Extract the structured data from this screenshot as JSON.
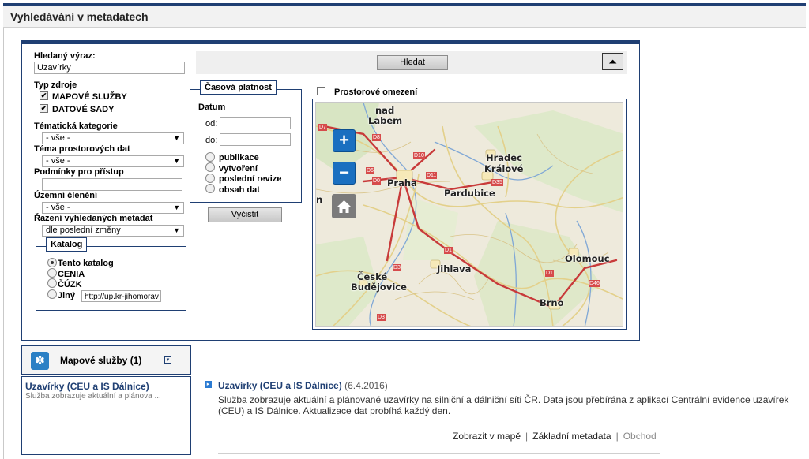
{
  "page": {
    "title": "Vyhledávání v metadatech"
  },
  "search": {
    "label": "Hledaný výraz:",
    "value": "Uzavírky",
    "button": "Hledat",
    "clear_button": "Vyčistit",
    "collapse_icon": "double-chevron-up-icon"
  },
  "source_type": {
    "label": "Typ zdroje",
    "options": [
      {
        "label": "MAPOVÉ SLUŽBY",
        "checked": true
      },
      {
        "label": "DATOVÉ SADY",
        "checked": true
      }
    ]
  },
  "filters": {
    "thematic_category": {
      "label": "Tématická kategorie",
      "value": "- vše -"
    },
    "spatial_theme": {
      "label": "Téma prostorových dat",
      "value": "- vše -"
    },
    "access_conditions": {
      "label": "Podmínky pro přístup",
      "value": ""
    },
    "territorial": {
      "label": "Územní členění",
      "value": "- vše -"
    },
    "sorting": {
      "label": "Řazení vyhledaných metadat",
      "value": "dle poslední změny"
    }
  },
  "catalog": {
    "legend": "Katalog",
    "options": [
      "Tento katalog",
      "CENIA",
      "ČÚZK",
      "Jiný"
    ],
    "selected": "Tento katalog",
    "other_url": "http://up.kr-jihomorav"
  },
  "time_validity": {
    "legend": "Časová platnost",
    "datum_label": "Datum",
    "from_label": "od:",
    "to_label": "do:",
    "options": [
      "publikace",
      "vytvoření",
      "poslední revize",
      "obsah dat"
    ]
  },
  "spatial": {
    "label": "Prostorové omezení",
    "checked": false
  },
  "map": {
    "zoom_in": "+",
    "zoom_out": "−",
    "home_icon": "home-icon",
    "cities": [
      "nad",
      "Labem",
      "Praha",
      "Hradec",
      "Králové",
      "Pardubice",
      "Jihlava",
      "Olomouc",
      "České",
      "Budějovice",
      "Brno",
      "n"
    ],
    "road_labels": [
      "D7",
      "D8",
      "D10",
      "D6",
      "D0",
      "D11",
      "D35",
      "D1",
      "D3",
      "D46",
      "D1",
      "D3"
    ]
  },
  "services": {
    "header": "Mapové služby (1)",
    "item_title": "Uzavírky (CEU a IS Dálnice)",
    "item_desc": "Služba zobrazuje aktuální a plánova ..."
  },
  "result": {
    "title": "Uzavírky (CEU a IS Dálnice)",
    "date": "(6.4.2016)",
    "description_1": "Služba zobrazuje aktuální a plánované uzavírky na silniční a dálniční síti ČR. Data jsou přebírána z aplikací Centrální evidence uzavírek",
    "description_2": "(CEU) a IS Dálnice. Aktualizace dat probíhá každý den.",
    "links": [
      "Zobrazit v mapě",
      "Základní metadata",
      "Obchod"
    ]
  }
}
